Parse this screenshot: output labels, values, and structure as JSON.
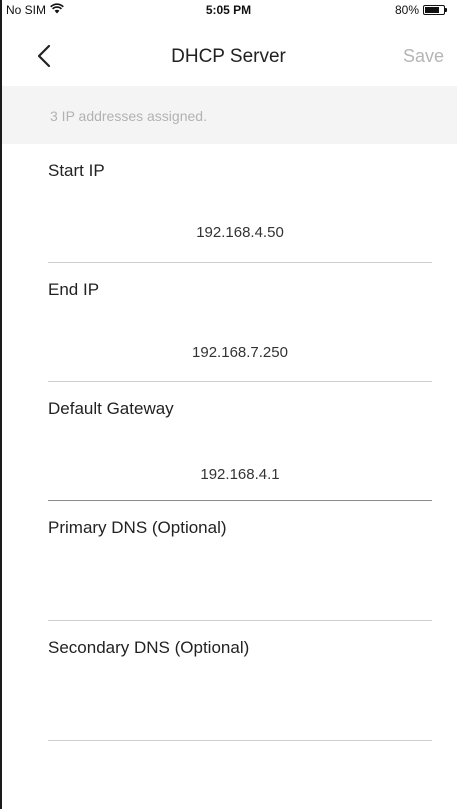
{
  "status_bar": {
    "carrier": "No SIM",
    "time": "5:05 PM",
    "battery_text": "80%",
    "battery_level": 0.8
  },
  "nav": {
    "title": "DHCP Server",
    "save_label": "Save"
  },
  "info": {
    "text": "3 IP addresses assigned."
  },
  "fields": [
    {
      "label": "Start IP",
      "value": "192.168.4.50"
    },
    {
      "label": "End IP",
      "value": "192.168.7.250"
    },
    {
      "label": "Default Gateway",
      "value": "192.168.4.1"
    },
    {
      "label": "Primary DNS (Optional)",
      "value": ""
    },
    {
      "label": "Secondary DNS (Optional)",
      "value": ""
    }
  ]
}
